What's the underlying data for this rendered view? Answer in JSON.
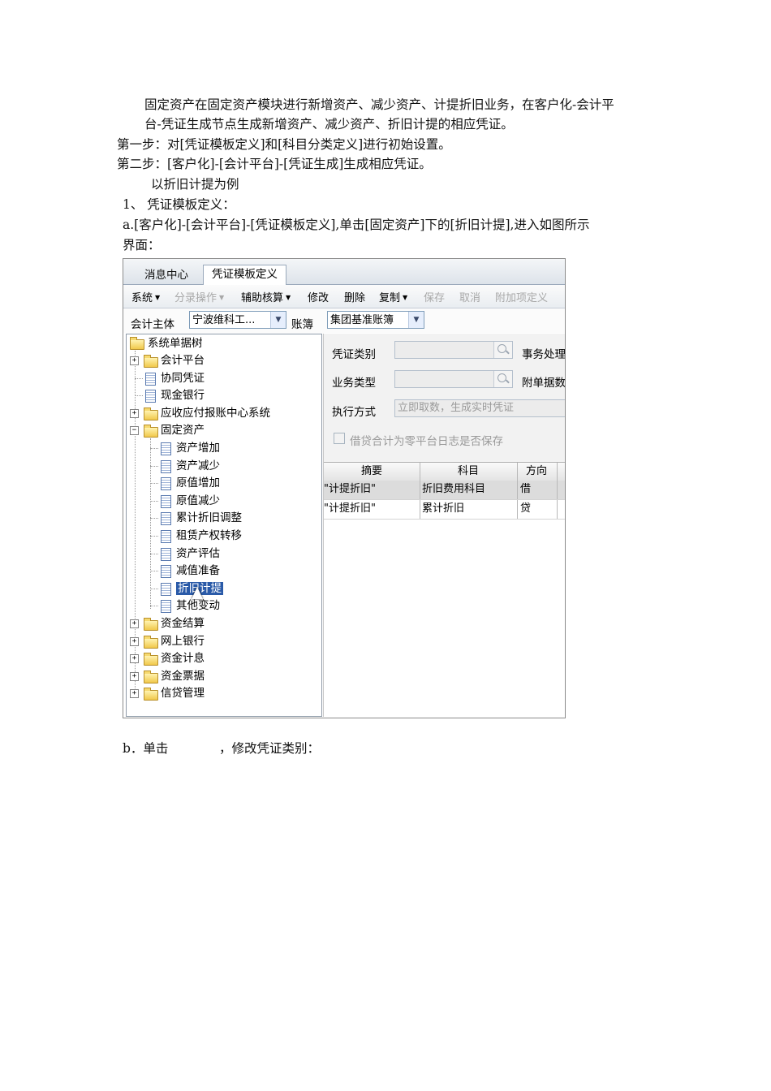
{
  "doc": {
    "intro_line1": "固定资产在固定资产模块进行新增资产、减少资产、计提折旧业务，在客户化-会计平",
    "intro_line2": "台-凭证生成节点生成新增资产、减少资产、折旧计提的相应凭证。",
    "step1": "第一步：对[凭证模板定义]和[科目分类定义]进行初始设置。",
    "step2": "第二步：[客户化]-[会计平台]-[凭证生成]生成相应凭证。",
    "example": "以折旧计提为例",
    "section1": "1、 凭证模板定义：",
    "step_a_line1": "a.[客户化]-[会计平台]-[凭证模板定义],单击[固定资产]下的[折旧计提],进入如图所示",
    "step_a_line2": "界面：",
    "step_b_prefix": "b．单击",
    "step_b_suffix": "，修改凭证类别："
  },
  "screenshot": {
    "tabs": [
      "消息中心",
      "凭证模板定义"
    ],
    "toolbar": [
      {
        "label": "系统",
        "dropdown": true,
        "disabled": false
      },
      {
        "label": "分录操作",
        "dropdown": true,
        "disabled": true
      },
      {
        "label": "辅助核算",
        "dropdown": true,
        "disabled": false
      },
      {
        "label": "修改",
        "dropdown": false,
        "disabled": false
      },
      {
        "label": "删除",
        "dropdown": false,
        "disabled": false
      },
      {
        "label": "复制",
        "dropdown": true,
        "disabled": false
      },
      {
        "label": "保存",
        "dropdown": false,
        "disabled": true
      },
      {
        "label": "取消",
        "dropdown": false,
        "disabled": true
      },
      {
        "label": "附加项定义",
        "dropdown": false,
        "disabled": true
      }
    ],
    "filter": {
      "entity_label": "会计主体",
      "entity_value": "宁波维科工...",
      "book_label": "账簿",
      "book_value": "集团基准账簿"
    },
    "tree": {
      "root": "系统单据树",
      "nodes": [
        {
          "label": "会计平台",
          "type": "folder",
          "expand": "+"
        },
        {
          "label": "协同凭证",
          "type": "doc"
        },
        {
          "label": "现金银行",
          "type": "doc"
        },
        {
          "label": "应收应付报账中心系统",
          "type": "folder",
          "expand": "+"
        },
        {
          "label": "固定资产",
          "type": "folder",
          "expand": "-"
        },
        {
          "label": "资产增加",
          "type": "doc",
          "child": true
        },
        {
          "label": "资产减少",
          "type": "doc",
          "child": true
        },
        {
          "label": "原值增加",
          "type": "doc",
          "child": true
        },
        {
          "label": "原值减少",
          "type": "doc",
          "child": true
        },
        {
          "label": "累计折旧调整",
          "type": "doc",
          "child": true
        },
        {
          "label": "租赁产权转移",
          "type": "doc",
          "child": true
        },
        {
          "label": "资产评估",
          "type": "doc",
          "child": true
        },
        {
          "label": "减值准备",
          "type": "doc",
          "child": true
        },
        {
          "label": "折旧计提",
          "type": "doc",
          "child": true,
          "selected": true
        },
        {
          "label": "其他变动",
          "type": "doc",
          "child": true
        },
        {
          "label": "资金结算",
          "type": "folder",
          "expand": "+"
        },
        {
          "label": "网上银行",
          "type": "folder",
          "expand": "+"
        },
        {
          "label": "资金计息",
          "type": "folder",
          "expand": "+"
        },
        {
          "label": "资金票据",
          "type": "folder",
          "expand": "+"
        },
        {
          "label": "信贷管理",
          "type": "folder",
          "expand": "+"
        }
      ]
    },
    "form": {
      "voucher_type_label": "凭证类别",
      "business_process_label": "事务处理",
      "business_type_label": "业务类型",
      "attachments_label": "附单据数",
      "exec_mode_label": "执行方式",
      "exec_mode_value": "立即取数，生成实时凭证",
      "checkbox_label": "借贷合计为零平台日志是否保存"
    },
    "grid": {
      "headers": [
        "摘要",
        "科目",
        "方向"
      ],
      "rows": [
        [
          "\"计提折旧\"",
          "折旧费用科目",
          "借"
        ],
        [
          "\"计提折旧\"",
          "累计折旧",
          "贷"
        ]
      ]
    }
  }
}
